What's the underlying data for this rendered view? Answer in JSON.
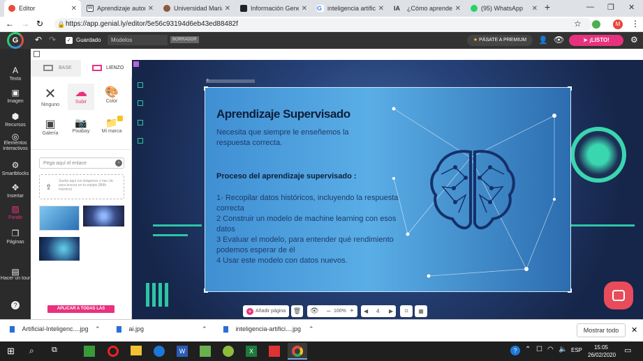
{
  "browser": {
    "tabs": [
      {
        "label": "Editor",
        "color": "#e84c3d"
      },
      {
        "label": "Aprendizaje autom",
        "color": "#444"
      },
      {
        "label": "Universidad Maria",
        "color": "#8a5a3c"
      },
      {
        "label": "Información Gene",
        "color": "#222"
      },
      {
        "label": "inteligencia artific",
        "color": "#4285f4"
      },
      {
        "label": "¿Cómo aprende la",
        "color": "#000"
      },
      {
        "label": "(95) WhatsApp",
        "color": "#25d366"
      }
    ],
    "new_tab": "+",
    "url": "https://app.genial.ly/editor/5e56c93194d6eb43ed88482f"
  },
  "appbar": {
    "saved": "Guardado",
    "doc_name": "Modelos",
    "draft": "BORRADOR",
    "premium": "PÁSATE A PREMIUM",
    "ready": "¡LISTO!"
  },
  "sidebar": {
    "items": [
      {
        "icon": "A",
        "label": "Texto"
      },
      {
        "icon": "▣",
        "label": "Imagen"
      },
      {
        "icon": "⬢",
        "label": "Recursos"
      },
      {
        "icon": "◎",
        "label": "Elementos interactivos"
      },
      {
        "icon": "⚙",
        "label": "Smartblocks"
      },
      {
        "icon": "✥",
        "label": "Insertar"
      },
      {
        "icon": "▨",
        "label": "Fondo"
      },
      {
        "icon": "❐",
        "label": "Páginas"
      },
      {
        "icon": "▤",
        "label": "Hacer un tour"
      },
      {
        "icon": "?",
        "label": ""
      }
    ]
  },
  "panel": {
    "tab_base": "BASE",
    "tab_canvas": "LIENZO",
    "options": [
      {
        "icon": "✕",
        "label": "Ninguno"
      },
      {
        "icon": "☁",
        "label": "Subir"
      },
      {
        "icon": "🎨",
        "label": "Color"
      },
      {
        "icon": "▣",
        "label": "Galería"
      },
      {
        "icon": "📷",
        "label": "Pixabay"
      },
      {
        "icon": "📁",
        "label": "Mi marca"
      }
    ],
    "link_placeholder": "Pega aquí el enlace",
    "upload_text": "Suelta aquí tus imágenes o haz clic para buscar en tu equipo (8Mb máximo)",
    "apply_all": "APLICAR A TODAS LAS PÁGINAS"
  },
  "slide": {
    "title": "Aprendizaje Supervisado",
    "intro": "Necesita que siempre le enseñemos la respuesta correcta.",
    "process_heading": "Proceso del aprendizaje supervisado :",
    "steps": [
      "1- Recopilar datos históricos, incluyendo la respuesta correcta",
      "2 Construir un modelo de machine learning con esos datos",
      "3 Evaluar el modelo, para entender qué rendimiento podemos esperar de él",
      "4 Usar este modelo con datos nuevos."
    ]
  },
  "bottombar": {
    "add_page": "Añadir página",
    "zoom": "100%",
    "page": "4"
  },
  "downloads": {
    "files": [
      "Artificial-Inteligenc....jpg",
      "ai.jpg",
      "inteligencia-artifici....jpg"
    ],
    "show_all": "Mostrar todo"
  },
  "taskbar": {
    "lang": "ESP",
    "time": "15:05",
    "date": "26/02/2020"
  },
  "colors": {
    "accent": "#e8327e",
    "appbar": "#333333",
    "premium": "#444444"
  }
}
